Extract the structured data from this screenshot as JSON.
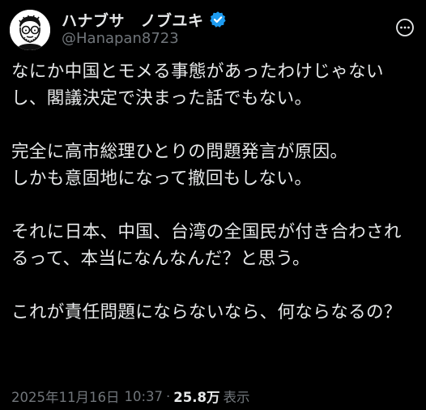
{
  "author": {
    "display_name": "ハナブサ　ノブユキ",
    "handle": "@Hanapan8723",
    "verified": true,
    "verified_color": "#1d9bf0"
  },
  "icons": {
    "verified": "verified-badge-icon",
    "more": "more-options-icon",
    "avatar": "cartoon-face-avatar"
  },
  "post": {
    "text": "なにか中国とモメる事態があったわけじゃないし、閣議決定で決まった話でもない。\n\n完全に高市総理ひとりの問題発言が原因。\nしかも意固地になって撤回もしない。\n\nそれに日本、中国、台湾の全国民が付き合わされるって、本当になんなんだ？と思う。\n\nこれが責任問題にならないなら、何ならなるの？"
  },
  "meta": {
    "date": "2025年11月16日",
    "time": "10:37",
    "separator": "·",
    "views": "25.8万",
    "views_label": "表示"
  },
  "colors": {
    "background": "#000000",
    "text": "#e7e9ea",
    "secondary": "#71767b"
  }
}
